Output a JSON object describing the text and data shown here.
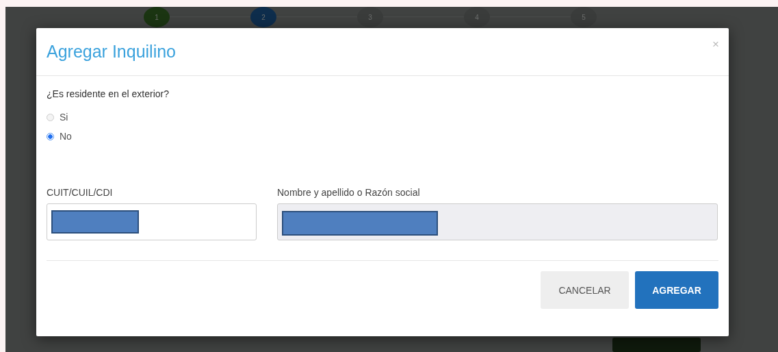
{
  "stepper": {
    "steps": [
      {
        "label": "1",
        "color": "#1b3512"
      },
      {
        "label": "2",
        "color": "#0e2d4c"
      },
      {
        "label": "3",
        "color": "#3a3c3b"
      },
      {
        "label": "4",
        "color": "#3a3c3b"
      },
      {
        "label": "5",
        "color": "#3a3c3b"
      }
    ]
  },
  "modal": {
    "title": "Agregar Inquilino",
    "close": "×",
    "question": "¿Es residente en el exterior?",
    "options": [
      {
        "label": "Si",
        "selected": false
      },
      {
        "label": "No",
        "selected": true
      }
    ],
    "fields": [
      {
        "label": "CUIT/CUIL/CDI",
        "disabled": false,
        "redacted": true
      },
      {
        "label": "Nombre y apellido o Razón social",
        "disabled": true,
        "redacted": true
      }
    ],
    "buttons": [
      {
        "label": "CANCELAR",
        "kind": "secondary"
      },
      {
        "label": "AGREGAR",
        "kind": "primary"
      }
    ]
  }
}
